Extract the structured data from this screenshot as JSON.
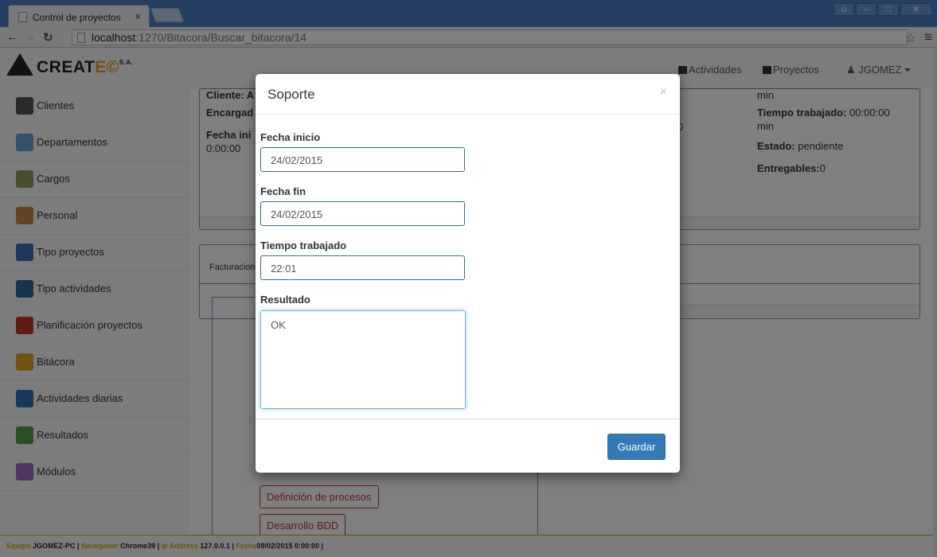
{
  "browser": {
    "tab_title": "Control de proyectos",
    "tab_close": "×",
    "url_host": "localhost",
    "url_path": ":1270/Bitacora/Buscar_bitacora/14"
  },
  "navbar": {
    "logo_text": "CREAT",
    "logo_accent": "E©",
    "logo_suffix": "S.A.",
    "actividades": "Actividades",
    "proyectos": "Proyectos",
    "user": "JGOMEZ"
  },
  "sidebar": {
    "items": [
      {
        "label": "Clientes",
        "color": "#555555"
      },
      {
        "label": "Departamentos",
        "color": "#6aa5d8"
      },
      {
        "label": "Cargos",
        "color": "#8aa060"
      },
      {
        "label": "Personal",
        "color": "#c9894e"
      },
      {
        "label": "Tipo proyectos",
        "color": "#3a6fb8"
      },
      {
        "label": "Tipo actividades",
        "color": "#2f6aa0"
      },
      {
        "label": "Planificación proyectos",
        "color": "#c0392b"
      },
      {
        "label": "Bitácora",
        "color": "#e0a92c"
      },
      {
        "label": "Actividades diarias",
        "color": "#2a6fb5"
      },
      {
        "label": "Resultados",
        "color": "#5a9a48"
      },
      {
        "label": "Módulos",
        "color": "#a06bc0"
      }
    ]
  },
  "background": {
    "cliente": "Cliente: A",
    "encargado": "Encargad",
    "fecha_ini": "Fecha ini",
    "hora": "0:00:00",
    "tiempo_top": "min",
    "tiempo_trabajado_label": "Tiempo trabajado:",
    "tiempo_trabajado_value": "00:00:00",
    "tiempo_unit": "min",
    "zero": "0",
    "estado_label": "Estado:",
    "estado_value": "pendiente",
    "entregables_label": "Entregables:",
    "entregables_value": "0",
    "facturacion": "Facturacion",
    "btn_definicion": "Definición de procesos",
    "btn_desarrollo": "Desarrollo BDD"
  },
  "modal": {
    "title": "Soporte",
    "close": "×",
    "fecha_inicio_label": "Fecha inicio",
    "fecha_inicio_value": "24/02/2015",
    "fecha_fin_label": "Fecha fin",
    "fecha_fin_value": "24/02/2015",
    "tiempo_label": "Tiempo trabajado",
    "tiempo_value": "22:01",
    "resultado_label": "Resultado",
    "resultado_value": "OK",
    "save_label": "Guardar"
  },
  "footer": {
    "equipo_k": "Equipo",
    "equipo_v": "JGOMEZ-PC |",
    "navegador_k": "Navegador",
    "navegador_v": "Chrome39 |",
    "ip_k": "Ip Address",
    "ip_v": "127.0.0.1 |",
    "fecha_k": "Fecha",
    "fecha_v": "09/02/2015 0:00:00 |"
  }
}
